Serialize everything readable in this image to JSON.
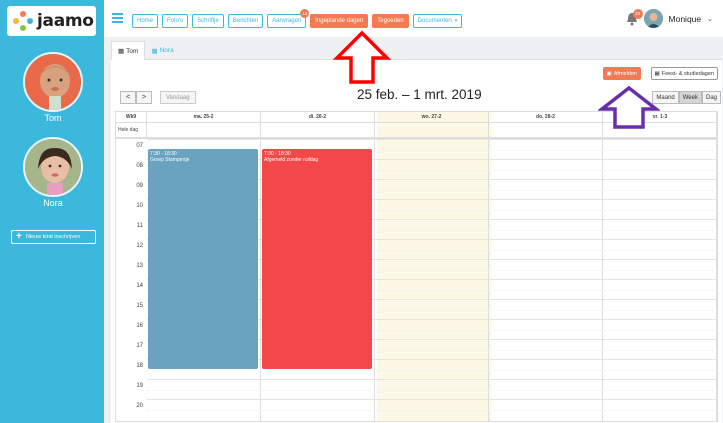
{
  "brand": {
    "name": "jaamo"
  },
  "sidebar": {
    "kids": [
      {
        "name": "Tom"
      },
      {
        "name": "Nora"
      }
    ],
    "new_kid_label": "Nieuw kind inschrijven"
  },
  "topbar": {
    "nav": [
      {
        "label": "Home"
      },
      {
        "label": "Foto's"
      },
      {
        "label": "Schriftje"
      },
      {
        "label": "Berichten"
      },
      {
        "label": "Aanvragen",
        "badge": "13"
      },
      {
        "label": "Ingeplande dagen"
      },
      {
        "label": "Tegoeden"
      },
      {
        "label": "Documenten"
      }
    ],
    "notification_count": "23",
    "user_name": "Monique"
  },
  "tabs": [
    {
      "label": "Tom"
    },
    {
      "label": "Nora"
    }
  ],
  "toolbar": {
    "absence_label": "Afmelden",
    "holidays_label": "Feest- & studiedagen",
    "prev_label": "<",
    "next_label": ">",
    "today_label": "Vandaag",
    "date_range": "25 feb. – 1 mrt. 2019",
    "views": [
      "Maand",
      "Week",
      "Dag"
    ]
  },
  "calendar": {
    "week_label": "Wk9",
    "allday_label": "Hele dag",
    "days": [
      "ma. 25-2",
      "di. 26-2",
      "wo. 27-2",
      "do. 28-2",
      "vr. 1-3"
    ],
    "hours": [
      "07",
      "08",
      "09",
      "10",
      "11",
      "12",
      "13",
      "14",
      "15",
      "16",
      "17",
      "18",
      "19",
      "20"
    ],
    "events": [
      {
        "day": 0,
        "time": "7:30 - 18:30",
        "title": "Groep Stampertje",
        "color": "#6aa3bf"
      },
      {
        "day": 1,
        "time": "7:30 - 18:30",
        "title": "Afgemeld zonder ruildag",
        "color": "#f34848"
      }
    ]
  },
  "colors": {
    "accent": "#3bb8dc",
    "orange": "#f47a53",
    "today_highlight": "#fcf8e3",
    "annotation_red": "#ff0000",
    "annotation_purple": "#6a2ea8"
  }
}
